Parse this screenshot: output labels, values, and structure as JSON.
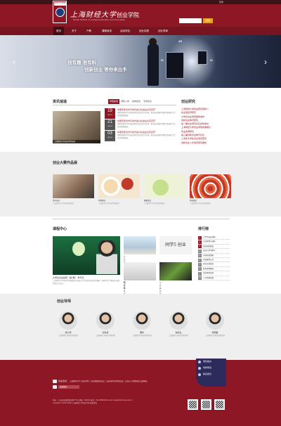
{
  "topbar": {
    "login_label": "登录"
  },
  "header": {
    "school_cn": "上海财经大学",
    "college_cn": "创业学院",
    "college_en": "SUFE School of entrepreneurship and innovation",
    "logo_caption": "SUFE COLLEGE",
    "search_placeholder": "",
    "search_button": "搜索"
  },
  "nav": {
    "items": [
      "首页",
      "关于",
      "产教",
      "课程培训",
      "活动项目",
      "创业实践",
      "创业导师"
    ]
  },
  "banner": {
    "slogan_line1": "很有趣 很有料",
    "slogan_line2": "创新创业 等你来出手",
    "roman": [
      "XII",
      "IX",
      "XI"
    ]
  },
  "news": {
    "title": "资讯速递",
    "tabs": [
      "学院新闻",
      "通知公告",
      "媒体报道",
      "专家视点"
    ],
    "photo_caption": "上海财经大学创业学院活动",
    "items": [
      {
        "day": "19",
        "month": "2015-12",
        "title": "中国专家访华行动方案讨论会在北京召开",
        "summary": "中国专家访华行动方案讨论会在北京召开，来自各方面的专家学者出席了会议并发表意见。"
      },
      {
        "day": "21",
        "month": "2015-12",
        "title": "中国专家访华行动方案讨论会在北京召开",
        "summary": "中国专家访华行动方案讨论会在北京召开，来自各方面的专家学者出席了会议并发表意见。"
      },
      {
        "day": "03",
        "month": "2015-12",
        "title": "中国专家访华行动方案讨论会在北京召开",
        "summary": "中国专家访华行动方案讨论会在北京召开，来自各方面的专家学者出席了会议并发表意见。"
      }
    ]
  },
  "research": {
    "title": "创业研究",
    "items": [
      "上海财经大学创业研究院简介",
      "创业型经济研究",
      "大学生创业调查报告发布",
      "创新创业教育研究",
      "第一期创业研究论坛成功举办",
      "上海财经大学创业学院成果展示",
      "创业案例研究",
      "第三届创新创业教育论坛",
      "上海市大学生创业项目研究",
      "创新创业人才培养研究报告"
    ]
  },
  "works": {
    "title": "创业大赛作品展",
    "items": [
      {
        "name": "青年创业",
        "desc": "上海财经大学创业项目展示"
      },
      {
        "name": "美食创业",
        "desc": "上海财经大学创业项目展示"
      },
      {
        "name": "健康饮品",
        "desc": "上海财经大学创业项目展示"
      },
      {
        "name": "特色食品",
        "desc": "上海财经大学创业项目展示"
      }
    ]
  },
  "course": {
    "title": "课程中心",
    "big_title": "大学生创业指南（第1期）  朱可清",
    "big_desc": "上海财经大学创业学院课程中心推出大学生创业指南系列课程，帮助学生了解创业的基本知识与方法。",
    "thumbs": [
      "企业发展中的竞争策略分析",
      "创业团队建设与管理",
      "企业财务管理课程",
      "创业项目实践分析"
    ],
    "thumb_text": "同学5 创业"
  },
  "ranking": {
    "title": "排行榜",
    "items": [
      "大学生创业项目",
      "企业管理与创新",
      "创业团队建设",
      "商业计划书撰写",
      "市场营销策略",
      "创业融资方式",
      "创业法律知识",
      "财务管理基础",
      "创业风险控制",
      "人力资源管理"
    ]
  },
  "mentors": {
    "title": "创业导师",
    "items": [
      {
        "name": "张大伟",
        "role": "上海财经大学创业学院导师"
      },
      {
        "name": "孙永勇",
        "role": "上海财经大学创业学院导师"
      },
      {
        "name": "董鸣",
        "role": "上海财经大学创业学院导师"
      },
      {
        "name": "谢永生",
        "role": "上海财经大学创业学院导师"
      },
      {
        "name": "何明星",
        "role": "上海财经大学创业学院导师"
      }
    ]
  },
  "footer": {
    "side_links": [
      "项目提交",
      "导师申请",
      "联系我们"
    ],
    "links_label": "快速通道",
    "links_text": "上海财经大学 | 创业学院 | 上海市教育委员会 | 上海市科学技术委员会 | 上海市人力资源和社会保障局",
    "select_label": "友情链接",
    "copyright_1": "地址：上海市杨浦区国定路777号 邮编：200433 电话：021-65904444 E-mail: sufe@mail.shufe.edu.cn",
    "copyright_2": "Copyright © 2015 SUFE 上海财经大学创业学院 版权所有"
  },
  "colors": {
    "brand": "#8e1725",
    "nav": "#781420",
    "accent": "#e8a21d",
    "side": "#2d2b5b"
  }
}
